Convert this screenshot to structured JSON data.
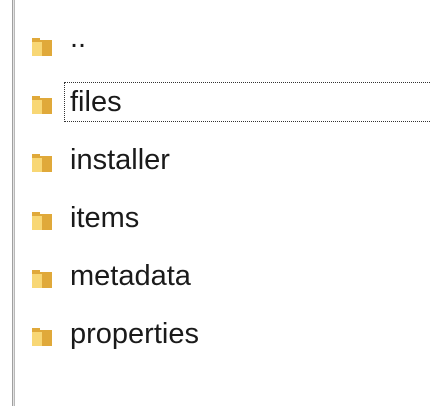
{
  "file_list": {
    "items": [
      {
        "name": "..",
        "icon": "folder-icon",
        "focused": false
      },
      {
        "name": "files",
        "icon": "folder-icon",
        "focused": true
      },
      {
        "name": "installer",
        "icon": "folder-icon",
        "focused": false
      },
      {
        "name": "items",
        "icon": "folder-icon",
        "focused": false
      },
      {
        "name": "metadata",
        "icon": "folder-icon",
        "focused": false
      },
      {
        "name": "properties",
        "icon": "folder-icon",
        "focused": false
      }
    ]
  },
  "colors": {
    "folder_front": "#f8d775",
    "folder_back": "#e0a93a",
    "text": "#1a1a1a",
    "background": "#ffffff"
  }
}
